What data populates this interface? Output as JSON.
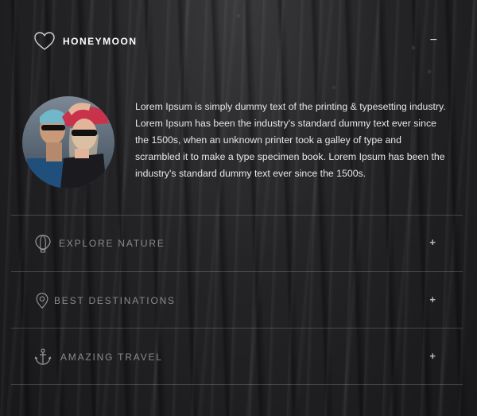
{
  "accordion": {
    "active": {
      "title": "HONEYMOON",
      "icon": "heart-icon",
      "toggle": "−",
      "body": "Lorem Ipsum is simply dummy text of the printing & typesetting industry. Lorem Ipsum has been the industry's standard dummy text ever since the 1500s, when an unknown printer took a galley of type and scrambled it to make a type specimen book. Lorem Ipsum has been the industry's standard dummy text ever since the 1500s."
    },
    "items": [
      {
        "title": "EXPLORE NATURE",
        "icon": "hot-air-balloon-icon",
        "toggle": "+"
      },
      {
        "title": "BEST DESTINATIONS",
        "icon": "location-pin-icon",
        "toggle": "+"
      },
      {
        "title": "AMAZING TRAVEL",
        "icon": "anchor-icon",
        "toggle": "+"
      }
    ]
  },
  "colors": {
    "active_title": "#ffffff",
    "inactive_title": "#8a8a8a",
    "divider": "rgba(255,255,255,0.18)"
  }
}
